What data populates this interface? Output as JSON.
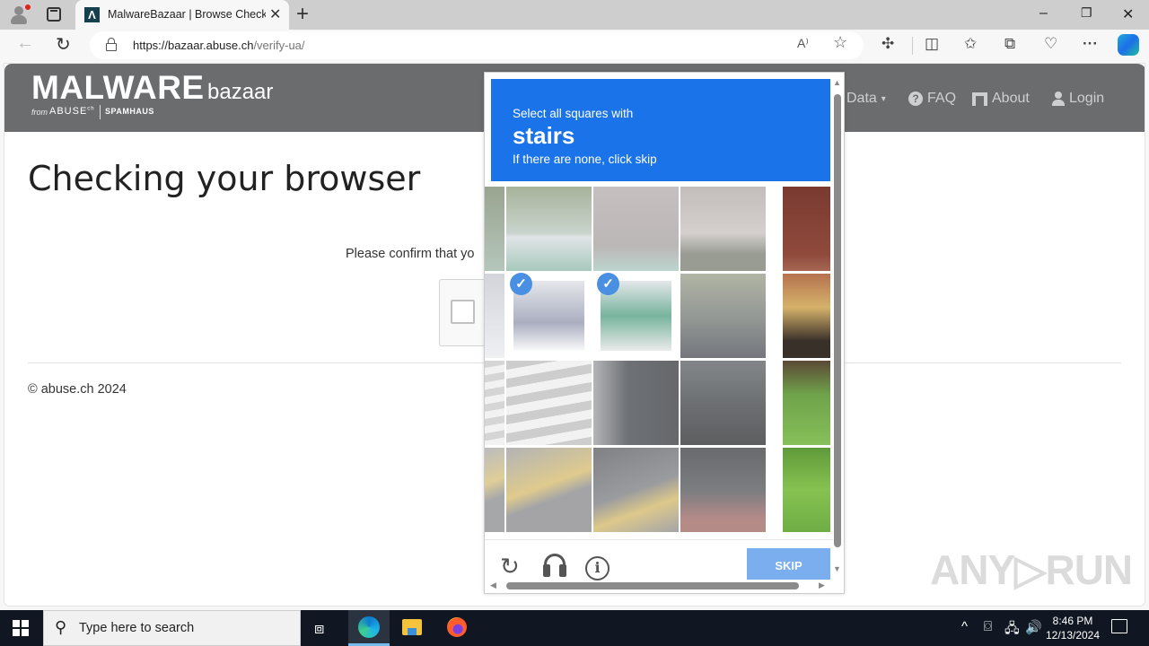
{
  "browser": {
    "tab_title": "MalwareBazaar | Browse Checking your browser",
    "favicon_glyph": "Λ",
    "url_host": "https://bazaar.abuse.ch",
    "url_path": "/verify-ua/",
    "window_controls": {
      "minimize": "–",
      "restore": "❐",
      "close": "✕"
    },
    "icons": {
      "profile": "profile-icon",
      "tab_actions": "tab-actions-icon",
      "back": "←",
      "reload": "↻",
      "read_aloud": "A⁾",
      "favorite": "☆",
      "extensions": "extensions-icon",
      "split_screen": "split-screen-icon",
      "favorites": "favorites-icon",
      "collections": "collections-icon",
      "browser_essentials": "browser-essentials-icon",
      "more": "···",
      "copilot": "copilot-icon"
    }
  },
  "site": {
    "logo": {
      "main": "MALWARE",
      "sub": "bazaar",
      "from": "from",
      "abuse": "ABUSE",
      "abuse_sup": "ch",
      "spamhaus": "SPAMHAUS"
    },
    "nav": [
      {
        "label": "Data",
        "icon": "▾"
      },
      {
        "label": "FAQ",
        "icon": "?"
      },
      {
        "label": "About",
        "icon": "about-icon"
      },
      {
        "label": "Login",
        "icon": "user-icon"
      }
    ],
    "heading": "Checking your browser",
    "confirm_text": "Please confirm that yo",
    "footer": "© abuse.ch 2024"
  },
  "challenge": {
    "instruction_line1": "Select all squares with",
    "target": "stairs",
    "instruction_line3": "If there are none, click skip",
    "grid": {
      "rows": 4,
      "cols": 5,
      "selected": [
        [
          1,
          1
        ],
        [
          1,
          2
        ]
      ]
    },
    "skip_label": "SKIP",
    "icons": {
      "reload": "↻",
      "audio": "headphones-icon",
      "info": "i"
    },
    "colors": {
      "header": "#1a73e8",
      "check": "#4a90e2",
      "skip": "#7aaeee"
    }
  },
  "watermark": "ANY▷RUN",
  "taskbar": {
    "search_placeholder": "Type here to search",
    "time": "8:46 PM",
    "date": "12/13/2024",
    "tray": {
      "chevron": "^",
      "meet": "⌼",
      "network": "🖧",
      "volume": "🔊"
    }
  }
}
